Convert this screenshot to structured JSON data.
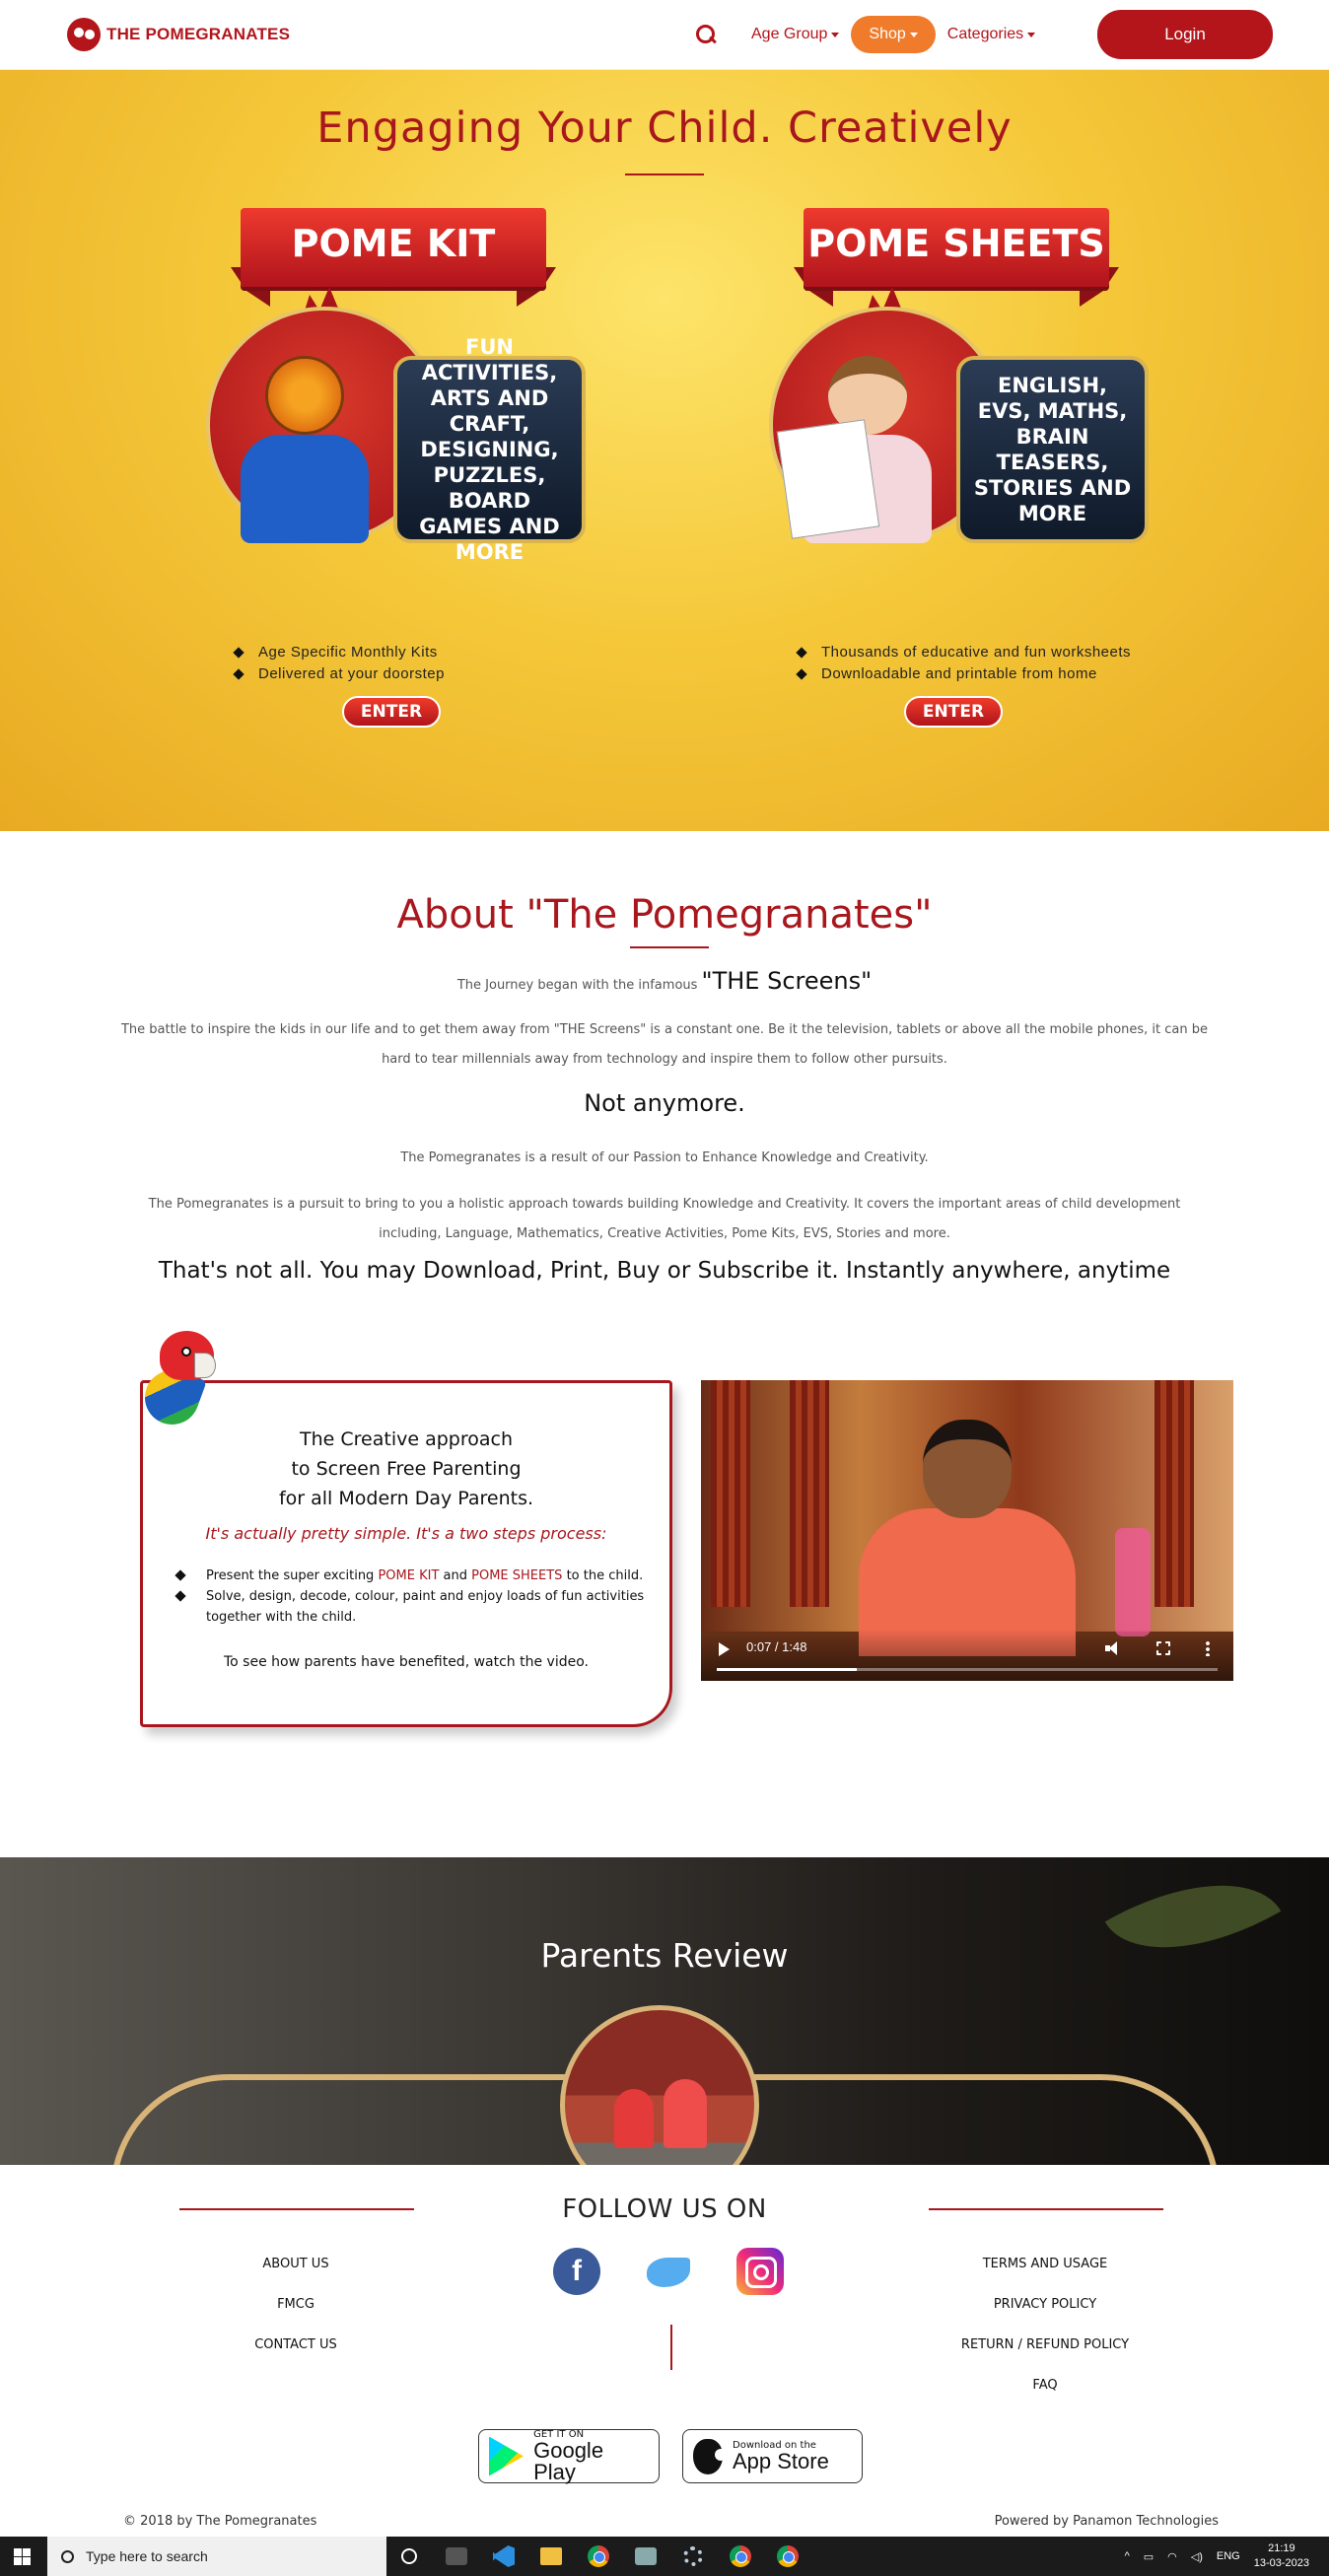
{
  "header": {
    "logo_text": "THE POMEGRANATES",
    "nav": {
      "age_group": "Age Group",
      "shop": "Shop",
      "categories": "Categories"
    },
    "login_label": "Login"
  },
  "hero": {
    "title": "Engaging Your Child. Creatively",
    "kit": {
      "ribbon": "POME KIT",
      "info": "FUN ACTIVITIES, ARTS AND CRAFT, DESIGNING, PUZZLES, BOARD GAMES AND MORE",
      "bullets": [
        "Age Specific Monthly Kits",
        "Delivered at your doorstep"
      ],
      "enter_label": "ENTER"
    },
    "sheets": {
      "ribbon": "POME SHEETS",
      "info": "ENGLISH, EVS, MATHS, BRAIN TEASERS, STORIES AND MORE",
      "bullets": [
        "Thousands of educative and fun worksheets",
        "Downloadable and printable from home"
      ],
      "enter_label": "ENTER"
    }
  },
  "about": {
    "title": "About \"The Pomegranates\"",
    "journey_prefix": "The Journey began with the infamous",
    "journey_highlight": "\"THE Screens\"",
    "p1": "The battle to inspire the kids in our life and to get them away from \"THE Screens\" is a constant one. Be it the television, tablets or above all the mobile phones, it can be hard to tear millennials away from technology and inspire them to follow other pursuits.",
    "h1": "Not anymore.",
    "p2": "The Pomegranates is a result of our Passion to Enhance Knowledge and Creativity.",
    "p3": "The Pomegranates is a pursuit to bring to you a holistic approach towards building Knowledge and Creativity. It covers the important areas of child development including, Language, Mathematics, Creative Activities, Pome Kits, EVS, Stories and more.",
    "h2": "That's not all. You may Download, Print, Buy or Subscribe it. Instantly anywhere, anytime"
  },
  "creative": {
    "title_line1": "The Creative approach",
    "title_line2": "to Screen Free Parenting",
    "title_line3": "for all Modern Day Parents.",
    "subtitle": "It's actually pretty simple. It's a two steps process:",
    "step1_pre": "Present the super exciting",
    "step1_kit": "POME KIT",
    "step1_and": "and",
    "step1_sheets": "POME SHEETS",
    "step1_post": "to the child.",
    "step2": "Solve, design, decode, colour, paint and enjoy loads of fun activities together with the child.",
    "footer": "To see how parents have benefited, watch the video."
  },
  "video": {
    "time": "0:07 / 1:48",
    "progress": 0.28
  },
  "reviews": {
    "title": "Parents Review"
  },
  "footer": {
    "follow_title": "FOLLOW US ON",
    "left_links": [
      "ABOUT US",
      "FMCG",
      "CONTACT US"
    ],
    "right_links": [
      "TERMS AND USAGE",
      "PRIVACY POLICY",
      "RETURN / REFUND POLICY",
      "FAQ"
    ],
    "social": {
      "facebook": "f",
      "twitter": "",
      "instagram": ""
    },
    "google_play_small": "GET IT ON",
    "google_play_big": "Google Play",
    "app_store_small": "Download on the",
    "app_store_big": "App Store",
    "copyright": "© 2018 by The Pomegranates",
    "powered": "Powered by Panamon Technologies"
  },
  "taskbar": {
    "search_placeholder": "Type here to search",
    "lang": "ENG",
    "time": "21:19",
    "date": "13-03-2023"
  },
  "colors": {
    "brand_red": "#b3151b",
    "shop_orange": "#f07b2b",
    "hero_yellow": "#f5c83a",
    "review_gold": "#d8b478"
  }
}
